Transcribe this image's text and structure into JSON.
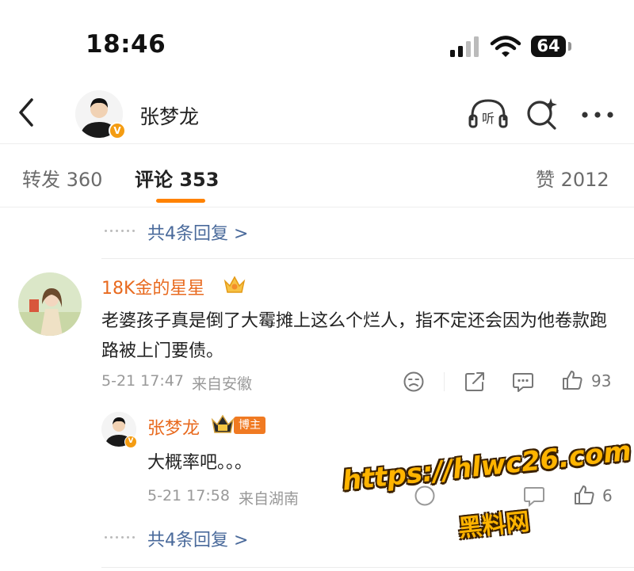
{
  "status_bar": {
    "time": "18:46",
    "battery": "64"
  },
  "nav": {
    "user_name": "张梦龙",
    "verified_badge": "V",
    "icons": [
      "back-arrow-icon",
      "listen-icon",
      "search-ai-icon",
      "more-icon"
    ]
  },
  "tabs": [
    {
      "label": "转发 360"
    },
    {
      "label": "评论 353"
    },
    {
      "label": "赞 2012"
    }
  ],
  "replies_link_top": "共4条回复 >",
  "comment": {
    "user": "18K金的星星",
    "text": "老婆孩子真是倒了大霉摊上这么个烂人，指不定还会因为他卷款跑路被上门要债。",
    "date": "5-21 17:47",
    "location": "来自安徽",
    "like_count": "93"
  },
  "reply": {
    "user": "张梦龙",
    "badge": "博主",
    "text": "大概率吧。。。",
    "date": "5-21 17:58",
    "location": "来自湖南",
    "like_count": "6"
  },
  "replies_link_bottom": "共4条回复 >",
  "watermark": {
    "url": "https://hlwc26.com",
    "site": "黑料网"
  },
  "colors": {
    "accent": "#ff8200",
    "name": "#e86a1f",
    "link": "#4a6a9b",
    "meta": "#999999"
  }
}
